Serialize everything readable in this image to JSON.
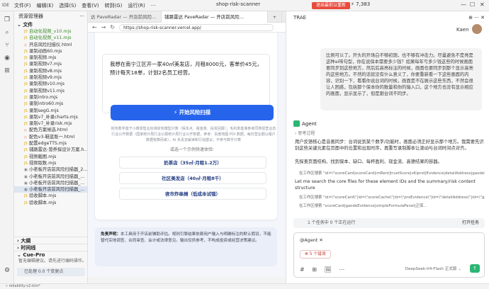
{
  "menubar": {
    "logo": "IDE",
    "items": [
      "文件(F)",
      "编辑(E)",
      "选择(S)",
      "查看(V)",
      "转到(G)",
      "运行(R)"
    ],
    "more": "···",
    "window_title": "shop-risk-scanner",
    "update_label": "退出最前以重新",
    "stars": "7,383"
  },
  "activity": [
    "files-icon",
    "search-icon",
    "git-icon",
    "debug-icon",
    "extensions-icon",
    "settings-icon"
  ],
  "sidebar": {
    "title": "资源管理器",
    "section": "文件",
    "items": [
      {
        "label": "自动化视频_v10.mjs",
        "type": "js",
        "green": true
      },
      {
        "label": "自动化视频_v11.mjs",
        "type": "js",
        "green": true
      },
      {
        "label": "开店风险扫描仪.html",
        "type": "html"
      },
      {
        "label": "录制动画60.mjs",
        "type": "js"
      },
      {
        "label": "录制视频.mjs",
        "type": "js"
      },
      {
        "label": "录制视频v7.mjs",
        "type": "js"
      },
      {
        "label": "录制视频v8.mjs",
        "type": "js"
      },
      {
        "label": "录制视频v9.mjs",
        "type": "js"
      },
      {
        "label": "录制视频v10.mjs",
        "type": "js"
      },
      {
        "label": "录制视频v11.mjs",
        "type": "js"
      },
      {
        "label": "录制intro.mjs",
        "type": "js"
      },
      {
        "label": "录制intro60.mjs",
        "type": "js"
      },
      {
        "label": "录制segG.mjs",
        "type": "js"
      },
      {
        "label": "录制v7_补录charts.mjs",
        "type": "js"
      },
      {
        "label": "录制v7_补录risk.mjs",
        "type": "js"
      },
      {
        "label": "配色方案候选.html",
        "type": "html"
      },
      {
        "label": "配色v3-鞋蓝既一.html",
        "type": "html"
      },
      {
        "label": "配置edgeTTS.mjs",
        "type": "js"
      },
      {
        "label": "铺路雷达-营养探设计方案.h...",
        "type": "js"
      },
      {
        "label": "视频截图.mjs",
        "type": "js"
      },
      {
        "label": "视频取数.mjs",
        "type": "js"
      },
      {
        "label": "小老板开店前风险扫描器_2...",
        "type": "img"
      },
      {
        "label": "小老板开店前风险扫描器_...",
        "type": "img"
      },
      {
        "label": "小老板开店前风险扫描器_...",
        "type": "img"
      },
      {
        "label": "小老板开店前风险扫描器_...",
        "type": "img",
        "selected": true
      },
      {
        "label": "验收脚本.mjs",
        "type": "js"
      },
      {
        "label": "验收脚本.mjs",
        "type": "js"
      }
    ],
    "bottom_sections": [
      "大纲",
      "时间线"
    ],
    "cue_title": "Cue-Pro",
    "cue_desc": "暂无编辑建议。请先进行编码操作。",
    "status": "已处理 0.0 个变更点"
  },
  "tabs": [
    {
      "label": "达 PaveRadar — 开店前风险...",
      "active": false
    },
    {
      "label": "铺路雷达 PaveRadar — 开店前风险...",
      "active": true
    },
    {
      "label": "+",
      "active": false
    }
  ],
  "url": "https://shop-risk-scanner.vercel.app/",
  "page": {
    "textarea": "我想在南宁江区开一家40㎡美发店，月租8000元，客单价45元，预计每天18单，计划2名员工经营。",
    "scan_button": "⚡ 开始风险扫描",
    "subnote": "财务数学基于小微零售业标准财务模型计算（保本点、租金率、投资回报）；毛利率基准参考同类经营业态行业公开数据（国家统计局行业公报统计局行业公开数据，参考：百度地图 POI 数据，每日营业额以租户数据核算而来）。AI 负责去解读和行动建议，不参与数字计算",
    "try_label": "或选一个示例快速体验:",
    "examples": [
      "奶茶店（35㎡·月租1.2万）",
      "社区美发店（40㎡·月租8千）",
      "夜市炸串摊（低成本试错）"
    ],
    "disclaimer_bold": "免责声明：",
    "disclaimer": "本工具用于开店前辅助评估。规则引擎结果依赖用户输入与明确标注的默认假设，不能替代实地调查、合同审查、会计或法律意见。输出仅供参考，不构成投资或经营决策建议。"
  },
  "statusbar": "reliability-v2-kim*",
  "panel": {
    "title": "TRAE",
    "user": "Kaen",
    "bubble": "比例可以了。开头的开场白不够初期，也不够有冲击力。尽量避免不是亮是这种ai味句型，你在说保本需要多少钱？如果每年亏多少钱这些的时候画面要同步到这些地方，然后后高亮标注的时候，画面也要同步到那个显示高亮的这些地方。不然的话就没有什么意义了，你要重新看一下这些画面的内容，识别一下，看看你说台词的时候，画面是不在展示这些东西，不然会很让人困惑，包括那个保本你的数量和你的输入口，这个地方也没有显示相应的画面，显示显示了，但是跟台词不同步。",
    "agent_name": "Agent",
    "think": "思考过程",
    "p1": "用户反馈核心是音画同步：台词说到某个数字/功能时，画面必须正好显示那个地方。我需要先识别这些关键元素在页面中的位置和出现时序，再重写录制脚本让滚动与台词时间点对齐。",
    "p2": "先探查页面结构、找到保本、缺口、每杯盈利、现金流、高德结果的容器。",
    "s1": "在工作区搜索 \"id=\\\"scoreCard|scoreCard|imRent|trustScore|vKiprot|Evidence|detailAddress|gaodeStatus|ga...",
    "p3": "Let me search the core files for these element IDs and the summary/risk content structure",
    "s2": "在工作区搜索 \"id=\\\"scoreCard\\\"|id=\\\"scoreCache\\\"|id=\\\"proEvidence\\\"|id=\\\"detailAddress\\\"|id=\\\"gaodeStatus\\\"|id=...",
    "s3": "在工作区搜索 \"scoreCard|gaodeEvidence|simpleFormulaPanel|正保...",
    "todo": "1 个任务中 0 个正在运行",
    "todo_right": "打开任务",
    "mention": "@Agent ✕",
    "error": "⊗ 5 个错误",
    "tools": "# ⊞ 🖼 ⋯",
    "model": "DeepSeek-V4-Flash 正式版 ⌄",
    "send": "↑"
  }
}
